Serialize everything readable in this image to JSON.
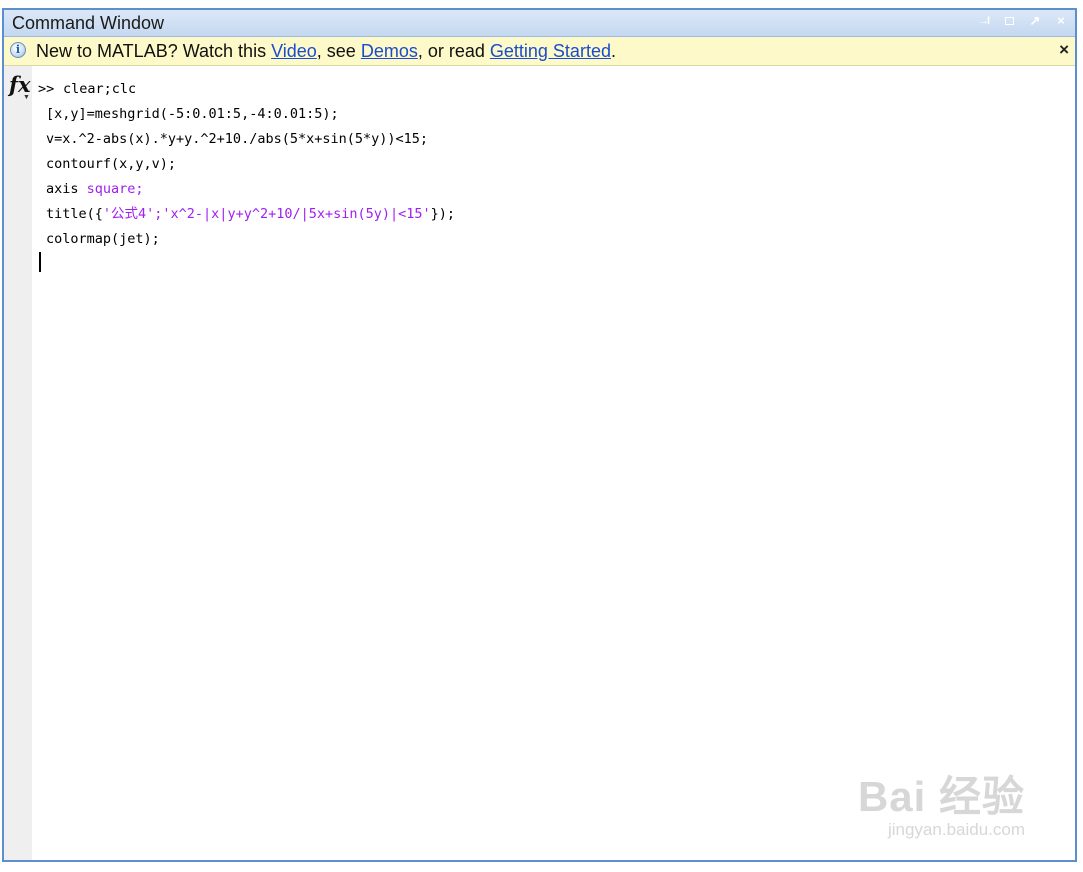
{
  "window": {
    "title": "Command Window",
    "controls": {
      "undock": "→I",
      "maximize": "□",
      "pin": "↗",
      "close": "×"
    }
  },
  "infobar": {
    "prefix": "New to MATLAB? Watch this ",
    "link_video": "Video",
    "mid1": ", see ",
    "link_demos": "Demos",
    "mid2": ", or read ",
    "link_getting_started": "Getting Started",
    "suffix": ".",
    "close": "×",
    "icon": "info-icon"
  },
  "gutter": {
    "fx": "fx",
    "arrow": "▼"
  },
  "code": {
    "prompt": ">>",
    "lines": [
      "clear;clc",
      "[x,y]=meshgrid(-5:0.01:5,-4:0.01:5);",
      "v=x.^2-abs(x).*y+y.^2+10./abs(5*x+sin(5*y))<15;",
      "contourf(x,y,v);",
      "axis ",
      "square;",
      "title({",
      "'公式4';'x^2-|x|y+y^2+10/|5x+sin(5y)|<15'",
      "});",
      "colormap(jet);"
    ]
  },
  "watermark": {
    "main": "Bai 经验",
    "sub": "jingyan.baidu.com"
  },
  "colors": {
    "frame_border": "#5b8fd0",
    "infobar_bg": "#fdf9c8",
    "link": "#1a4cd0",
    "string": "#a020f0"
  }
}
